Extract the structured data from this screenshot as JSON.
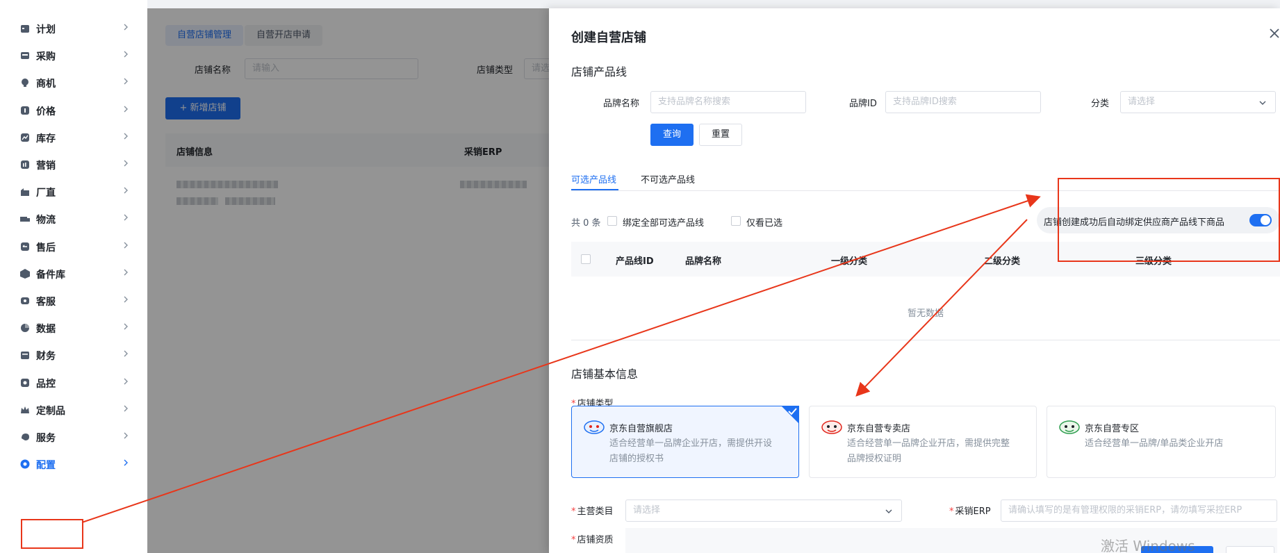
{
  "sidebar": {
    "items": [
      {
        "label": "计划",
        "icon": "calendar-icon"
      },
      {
        "label": "采购",
        "icon": "cart-icon"
      },
      {
        "label": "商机",
        "icon": "bulb-icon"
      },
      {
        "label": "价格",
        "icon": "price-icon"
      },
      {
        "label": "库存",
        "icon": "trend-icon"
      },
      {
        "label": "营销",
        "icon": "bar-chart-icon"
      },
      {
        "label": "厂直",
        "icon": "factory-icon"
      },
      {
        "label": "物流",
        "icon": "truck-icon"
      },
      {
        "label": "售后",
        "icon": "return-icon"
      },
      {
        "label": "备件库",
        "icon": "box-icon"
      },
      {
        "label": "客服",
        "icon": "headset-icon"
      },
      {
        "label": "数据",
        "icon": "pie-icon"
      },
      {
        "label": "财务",
        "icon": "wallet-icon"
      },
      {
        "label": "品控",
        "icon": "shield-icon"
      },
      {
        "label": "定制品",
        "icon": "crown-icon"
      },
      {
        "label": "服务",
        "icon": "service-icon"
      },
      {
        "label": "配置",
        "icon": "config-icon"
      }
    ]
  },
  "main": {
    "tabs": [
      "自营店铺管理",
      "自营开店申请"
    ],
    "filter_store_name_label": "店铺名称",
    "filter_store_name_placeholder": "请输入",
    "filter_store_type_label": "店铺类型",
    "filter_store_type_placeholder": "请选",
    "add_button": "+ 新增店铺",
    "table_headers": [
      "店铺信息",
      "采销ERP"
    ]
  },
  "drawer": {
    "title": "创建自营店铺",
    "product_line_section": "店铺产品线",
    "brand_name_label": "品牌名称",
    "brand_name_placeholder": "支持品牌名称搜索",
    "brand_id_label": "品牌ID",
    "brand_id_placeholder": "支持品牌ID搜索",
    "category_label": "分类",
    "category_placeholder": "请选择",
    "query_button": "查询",
    "reset_button": "重置",
    "tabs": [
      "可选产品线",
      "不可选产品线"
    ],
    "count_text": "共 0 条",
    "bind_all_label": "绑定全部可选产品线",
    "only_selected_label": "仅看已选",
    "auto_bind_label": "店铺创建成功后自动绑定供应商产品线下商品",
    "auto_bind_on": true,
    "table_headers": [
      "产品线ID",
      "品牌名称",
      "一级分类",
      "二级分类",
      "三级分类"
    ],
    "empty_text": "暂无数据",
    "basic_info_section": "店铺基本信息",
    "store_type_label": "店铺类型",
    "store_types": [
      {
        "title": "京东自营旗舰店",
        "desc": "适合经营单一品牌企业开店，需提供开设店铺的授权书",
        "desc_line1": "适合经营单一品牌企业开店，需提供开设",
        "desc_line2": "店铺的授权书",
        "selected": true
      },
      {
        "title": "京东自营专卖店",
        "desc": "适合经营单一品牌企业开店，需提供完整品牌授权证明",
        "desc_line1": "适合经营单一品牌企业开店，需提供完整",
        "desc_line2": "品牌授权证明",
        "selected": false
      },
      {
        "title": "京东自营专区",
        "desc": "适合经营单一品牌/单品类企业开店",
        "desc_line1": "适合经营单一品牌/单品类企业开店",
        "desc_line2": "",
        "selected": false
      }
    ],
    "main_category_label": "主营类目",
    "main_category_placeholder": "请选择",
    "erp_label": "采销ERP",
    "erp_placeholder": "请确认填写的是有管理权限的采销ERP，请勿填写采控ERP",
    "qualification_label": "店铺资质"
  },
  "watermark": "激活 Windows",
  "colors": {
    "primary": "#1e6ff1",
    "annotation": "#e8361a",
    "required": "#f53f3f"
  }
}
